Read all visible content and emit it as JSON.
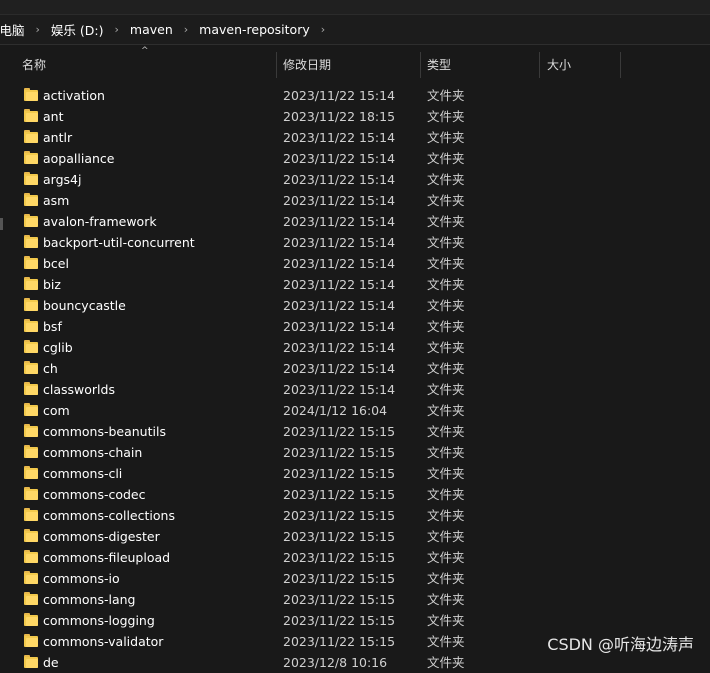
{
  "breadcrumb": [
    {
      "label": "此电脑"
    },
    {
      "label": "娱乐 (D:)"
    },
    {
      "label": "maven"
    },
    {
      "label": "maven-repository"
    }
  ],
  "columns": {
    "name": "名称",
    "date": "修改日期",
    "type": "类型",
    "size": "大小"
  },
  "files": [
    {
      "name": "activation",
      "date": "2023/11/22 15:14",
      "type": "文件夹"
    },
    {
      "name": "ant",
      "date": "2023/11/22 18:15",
      "type": "文件夹"
    },
    {
      "name": "antlr",
      "date": "2023/11/22 15:14",
      "type": "文件夹"
    },
    {
      "name": "aopalliance",
      "date": "2023/11/22 15:14",
      "type": "文件夹"
    },
    {
      "name": "args4j",
      "date": "2023/11/22 15:14",
      "type": "文件夹"
    },
    {
      "name": "asm",
      "date": "2023/11/22 15:14",
      "type": "文件夹"
    },
    {
      "name": "avalon-framework",
      "date": "2023/11/22 15:14",
      "type": "文件夹"
    },
    {
      "name": "backport-util-concurrent",
      "date": "2023/11/22 15:14",
      "type": "文件夹"
    },
    {
      "name": "bcel",
      "date": "2023/11/22 15:14",
      "type": "文件夹"
    },
    {
      "name": "biz",
      "date": "2023/11/22 15:14",
      "type": "文件夹"
    },
    {
      "name": "bouncycastle",
      "date": "2023/11/22 15:14",
      "type": "文件夹"
    },
    {
      "name": "bsf",
      "date": "2023/11/22 15:14",
      "type": "文件夹"
    },
    {
      "name": "cglib",
      "date": "2023/11/22 15:14",
      "type": "文件夹"
    },
    {
      "name": "ch",
      "date": "2023/11/22 15:14",
      "type": "文件夹"
    },
    {
      "name": "classworlds",
      "date": "2023/11/22 15:14",
      "type": "文件夹"
    },
    {
      "name": "com",
      "date": "2024/1/12 16:04",
      "type": "文件夹"
    },
    {
      "name": "commons-beanutils",
      "date": "2023/11/22 15:15",
      "type": "文件夹"
    },
    {
      "name": "commons-chain",
      "date": "2023/11/22 15:15",
      "type": "文件夹"
    },
    {
      "name": "commons-cli",
      "date": "2023/11/22 15:15",
      "type": "文件夹"
    },
    {
      "name": "commons-codec",
      "date": "2023/11/22 15:15",
      "type": "文件夹"
    },
    {
      "name": "commons-collections",
      "date": "2023/11/22 15:15",
      "type": "文件夹"
    },
    {
      "name": "commons-digester",
      "date": "2023/11/22 15:15",
      "type": "文件夹"
    },
    {
      "name": "commons-fileupload",
      "date": "2023/11/22 15:15",
      "type": "文件夹"
    },
    {
      "name": "commons-io",
      "date": "2023/11/22 15:15",
      "type": "文件夹"
    },
    {
      "name": "commons-lang",
      "date": "2023/11/22 15:15",
      "type": "文件夹"
    },
    {
      "name": "commons-logging",
      "date": "2023/11/22 15:15",
      "type": "文件夹"
    },
    {
      "name": "commons-validator",
      "date": "2023/11/22 15:15",
      "type": "文件夹"
    },
    {
      "name": "de",
      "date": "2023/12/8 10:16",
      "type": "文件夹"
    }
  ],
  "watermark": "CSDN @听海边涛声",
  "icons": {
    "folder": "folder-icon",
    "chevron": "chevron-right-icon",
    "sort": "sort-up-icon"
  },
  "colors": {
    "background": "#191919",
    "folder": "#f2c94c",
    "text": "#ffffff"
  }
}
